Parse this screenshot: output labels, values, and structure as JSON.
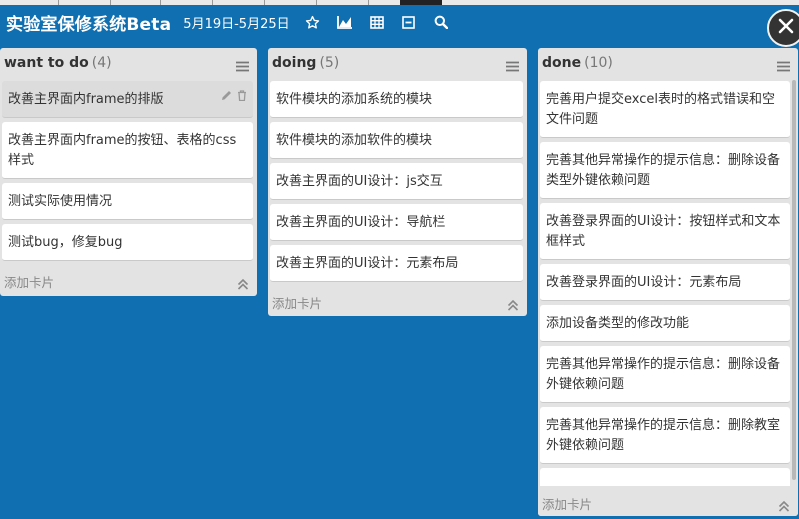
{
  "header": {
    "title": "实验室保修系统Beta",
    "date_range": "5月19日-5月25日",
    "icons": [
      "star-icon",
      "chart-icon",
      "grid-icon",
      "minus-box-icon",
      "search-icon",
      "close-icon"
    ]
  },
  "colors": {
    "background": "#0f6fb0",
    "list_bg": "#e3e3e3",
    "card_bg": "#ffffff"
  },
  "lists": [
    {
      "name": "want to do",
      "count": "(4)",
      "add_label": "添加卡片",
      "cards": [
        "改善主界面内frame的排版",
        "改善主界面内frame的按钮、表格的css样式",
        "测试实际使用情况",
        "测试bug，修复bug"
      ]
    },
    {
      "name": "doing",
      "count": "(5)",
      "add_label": "添加卡片",
      "cards": [
        "软件模块的添加系统的模块",
        "软件模块的添加软件的模块",
        "改善主界面的UI设计：js交互",
        "改善主界面的UI设计：导航栏",
        "改善主界面的UI设计：元素布局"
      ]
    },
    {
      "name": "done",
      "count": "(10)",
      "add_label": "添加卡片",
      "cards": [
        "完善用户提交excel表时的格式错误和空文件问题",
        "完善其他异常操作的提示信息：删除设备类型外键依赖问题",
        "改善登录界面的UI设计：按钮样式和文本框样式",
        "改善登录界面的UI设计：元素布局",
        "添加设备类型的修改功能",
        "完善其他异常操作的提示信息：删除设备外键依赖问题",
        "完善其他异常操作的提示信息：删除教室外键依赖问题"
      ]
    }
  ]
}
